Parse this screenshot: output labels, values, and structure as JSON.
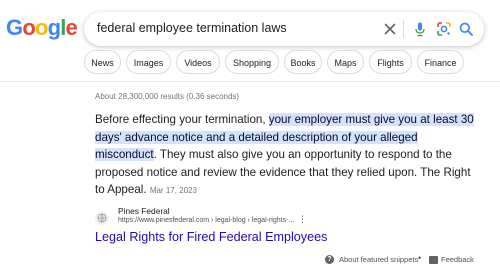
{
  "logo": {
    "text": "Google",
    "letters": [
      "G",
      "o",
      "o",
      "g",
      "l",
      "e"
    ],
    "colors": [
      "#4285f4",
      "#ea4335",
      "#fbbc05",
      "#4285f4",
      "#34a853",
      "#ea4335"
    ]
  },
  "search": {
    "query": "federal employee termination laws"
  },
  "icons": {
    "clear": "close-icon",
    "voice": "microphone-icon",
    "lens": "google-lens-icon",
    "search": "search-icon"
  },
  "chips": [
    "News",
    "Images",
    "Videos",
    "Shopping",
    "Books",
    "Maps",
    "Flights",
    "Finance"
  ],
  "results_count": "About 28,300,000 results (0.36 seconds)",
  "snippet": {
    "before": "Before effecting your termination, ",
    "highlight": "your employer must give you at least 30 days' advance notice and a detailed description of your alleged misconduct",
    "after": ". They must also give you an opportunity to respond to the proposed notice and review the evidence that they relied upon. The Right to Appeal.",
    "date": "Mar 17, 2023"
  },
  "source": {
    "name": "Pines Federal",
    "url": "https://www.pinesfederal.com › legal-blog › legal-rights-...",
    "more": "⋮"
  },
  "result_title": "Legal Rights for Fired Federal Employees",
  "footer": {
    "about": "About featured snippets",
    "separator": "•",
    "feedback": "Feedback"
  },
  "colors": {
    "link": "#1a0dab",
    "highlight_bg": "#d3e3fd"
  }
}
